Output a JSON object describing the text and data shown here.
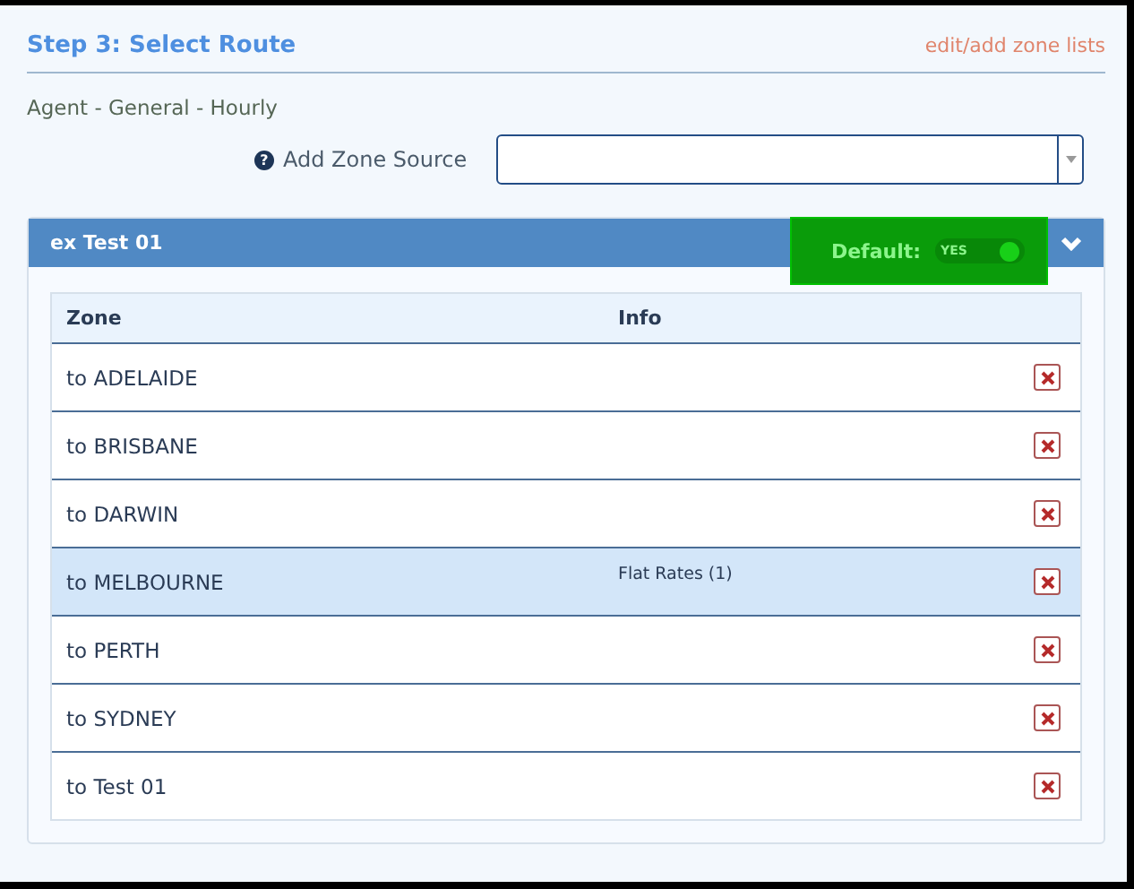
{
  "header": {
    "title": "Step 3: Select Route",
    "link": "edit/add zone lists"
  },
  "subtitle": "Agent - General - Hourly",
  "zone_source": {
    "label": "Add Zone Source",
    "help_icon": "?"
  },
  "panel": {
    "title": "ex Test 01",
    "default_label": "Default:",
    "default_toggle": {
      "label": "YES",
      "on": true
    },
    "highlighted": true
  },
  "table": {
    "columns": [
      "Zone",
      "Info"
    ],
    "rows": [
      {
        "zone": "to ADELAIDE",
        "info": "",
        "selected": false
      },
      {
        "zone": "to BRISBANE",
        "info": "",
        "selected": false
      },
      {
        "zone": "to DARWIN",
        "info": "",
        "selected": false
      },
      {
        "zone": "to MELBOURNE",
        "info": "Flat Rates (1)",
        "selected": true
      },
      {
        "zone": "to PERTH",
        "info": "",
        "selected": false
      },
      {
        "zone": "to SYDNEY",
        "info": "",
        "selected": false
      },
      {
        "zone": "to Test 01",
        "info": "",
        "selected": false
      }
    ]
  }
}
